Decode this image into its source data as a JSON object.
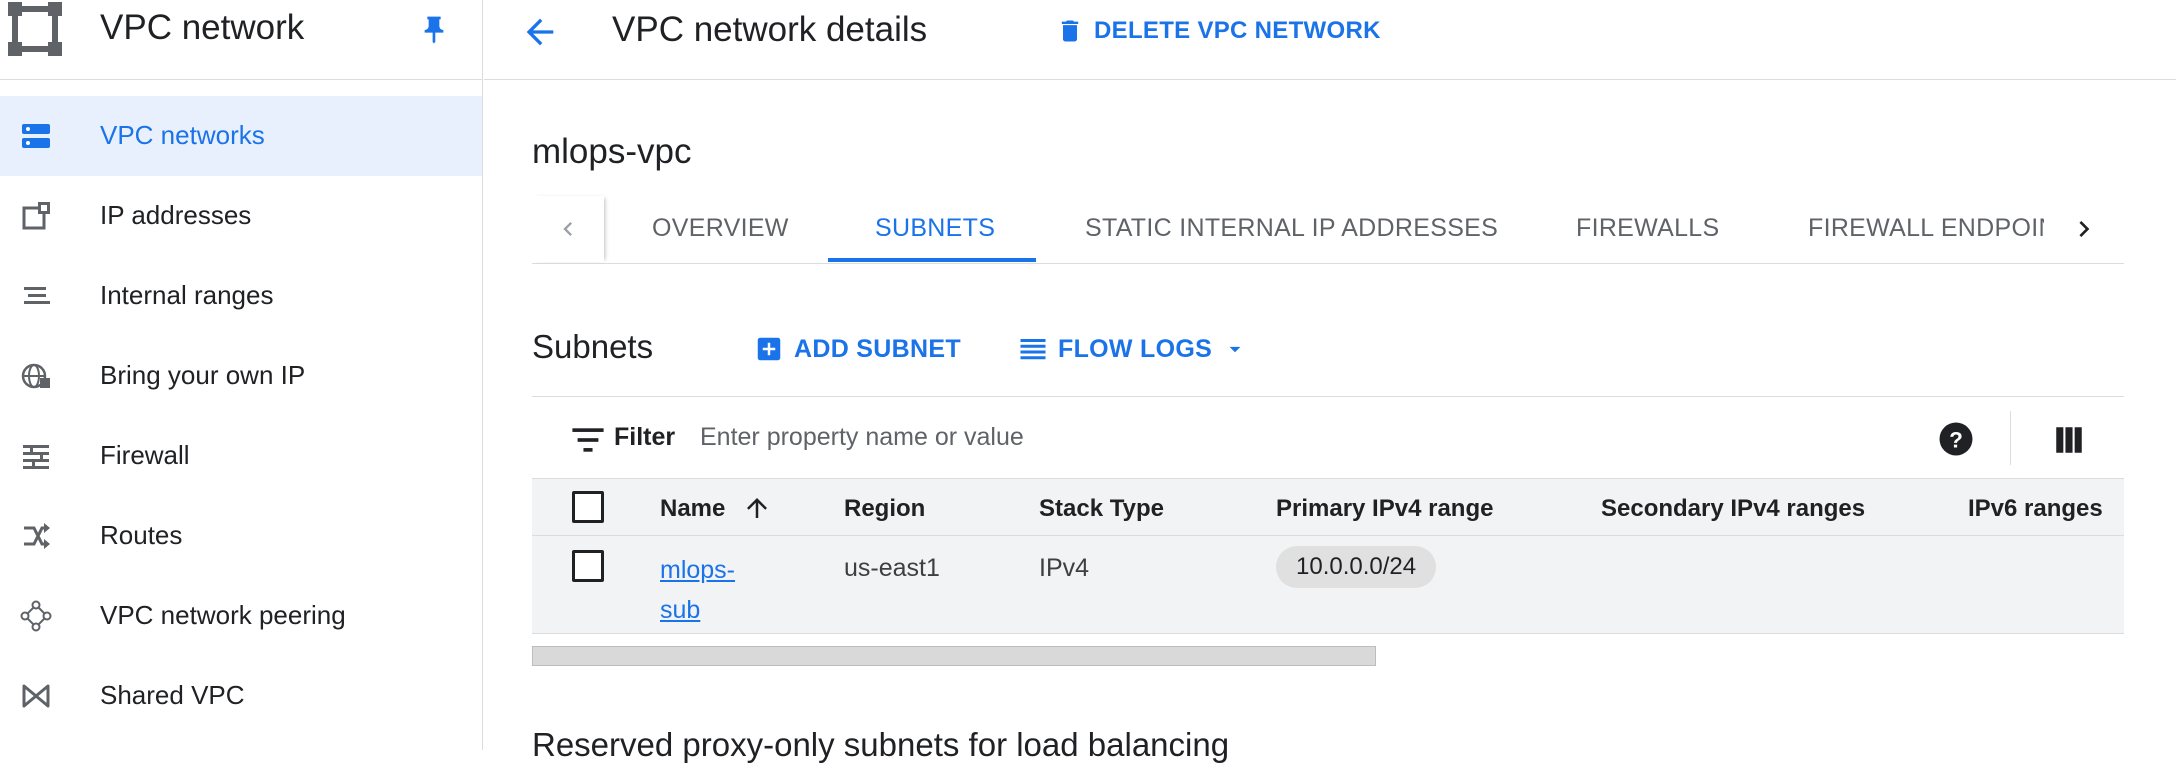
{
  "sidebar": {
    "title": "VPC network",
    "items": [
      {
        "label": "VPC networks",
        "icon": "vpc-networks-icon",
        "active": true
      },
      {
        "label": "IP addresses",
        "icon": "ip-addresses-icon",
        "active": false
      },
      {
        "label": "Internal ranges",
        "icon": "internal-ranges-icon",
        "active": false
      },
      {
        "label": "Bring your own IP",
        "icon": "globe-icon",
        "active": false
      },
      {
        "label": "Firewall",
        "icon": "firewall-icon",
        "active": false
      },
      {
        "label": "Routes",
        "icon": "routes-icon",
        "active": false
      },
      {
        "label": "VPC network peering",
        "icon": "peering-icon",
        "active": false
      },
      {
        "label": "Shared VPC",
        "icon": "shared-vpc-icon",
        "active": false
      }
    ]
  },
  "header": {
    "title": "VPC network details",
    "delete_label": "DELETE VPC NETWORK"
  },
  "network": {
    "name": "mlops-vpc"
  },
  "tabs": [
    {
      "label": "OVERVIEW",
      "active": false
    },
    {
      "label": "SUBNETS",
      "active": true
    },
    {
      "label": "STATIC INTERNAL IP ADDRESSES",
      "active": false
    },
    {
      "label": "FIREWALLS",
      "active": false
    },
    {
      "label": "FIREWALL ENDPOINTS",
      "active": false
    }
  ],
  "subnets": {
    "title": "Subnets",
    "add_label": "ADD SUBNET",
    "flow_logs_label": "FLOW LOGS",
    "filter": {
      "label": "Filter",
      "placeholder": "Enter property name or value"
    },
    "columns": [
      "Name",
      "Region",
      "Stack Type",
      "Primary IPv4 range",
      "Secondary IPv4 ranges",
      "IPv6 ranges"
    ],
    "rows": [
      {
        "name_line1": "mlops-",
        "name_line2": "sub",
        "region": "us-east1",
        "stack_type": "IPv4",
        "primary_ipv4": "10.0.0.0/24",
        "secondary_ipv4": "",
        "ipv6": ""
      }
    ]
  },
  "section2": {
    "title": "Reserved proxy-only subnets for load balancing"
  },
  "colors": {
    "accent": "#1a73e8",
    "active_bg": "#e8f0fe",
    "table_bg": "#f1f3f4"
  }
}
